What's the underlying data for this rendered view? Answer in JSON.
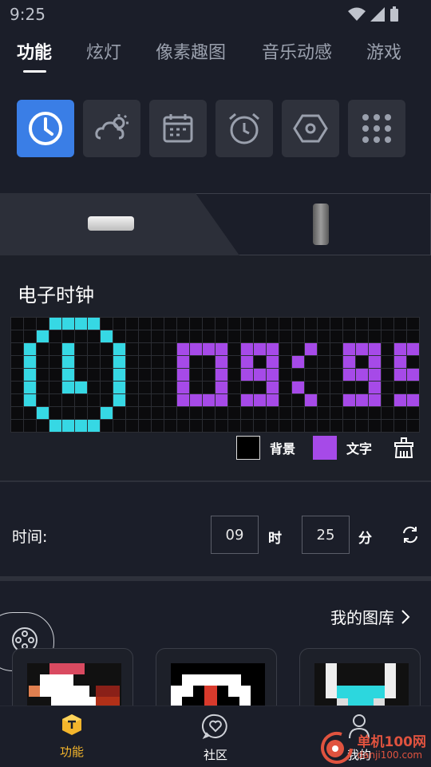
{
  "status": {
    "time": "9:25"
  },
  "tabs": [
    {
      "label": "功能"
    },
    {
      "label": "炫灯"
    },
    {
      "label": "像素趣图"
    },
    {
      "label": "音乐动感"
    },
    {
      "label": "游戏"
    }
  ],
  "function_icons": [
    "clock-icon",
    "weather-icon",
    "calendar-icon",
    "alarm-icon",
    "hexagon-icon",
    "grid-dots-icon"
  ],
  "clock": {
    "title": "电子时钟",
    "grid_rows": [
      "...cccc.........................",
      "..c....c........................",
      ".c..c...c....pppp.ppp..p..ppp.ppp",
      ".c..c...c....p..p.p.p.p...p.p.p..",
      ".c..c...c....p..p.ppp.....ppp.ppp",
      ".c..cc..c....p..p...p.p.....p...p",
      ".c......c....pppp.ppp..p..ppp.ppp",
      "..c....c........................",
      "...cccc........................."
    ],
    "bg_label": "背景",
    "text_label": "文字",
    "bg_color": "#000000",
    "text_color": "#a64ae8",
    "led_cyan": "#36d8e4"
  },
  "time": {
    "label": "时间:",
    "hour": "09",
    "hour_unit": "时",
    "minute": "25",
    "minute_unit": "分"
  },
  "gallery": {
    "link": "我的图库"
  },
  "nav": [
    {
      "label": "功能",
      "icon": "cube-icon"
    },
    {
      "label": "社区",
      "icon": "heart-chat-icon"
    },
    {
      "label": "我的",
      "icon": "person-icon"
    }
  ],
  "watermark": {
    "title": "单机100网",
    "url": "danji100.com"
  }
}
